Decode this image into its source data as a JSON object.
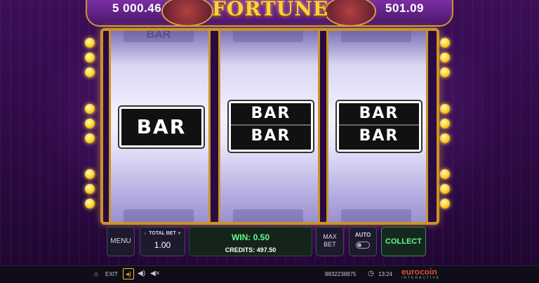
{
  "header": {
    "balance_left": "5 000.46",
    "balance_right": "501.09",
    "logo_text": "FORTUNE"
  },
  "reels": [
    {
      "symbol_lines": [
        "BAR"
      ],
      "ghost_top": "BAR"
    },
    {
      "symbol_lines": [
        "BAR",
        "BAR"
      ]
    },
    {
      "symbol_lines": [
        "BAR",
        "BAR"
      ]
    }
  ],
  "controls": {
    "menu_label": "MENU",
    "total_bet_label": "TOTAL BET",
    "total_bet_minus": "-",
    "total_bet_plus": "+",
    "total_bet_value": "1.00",
    "win_text": "WIN: 0.50",
    "credits_text": "CREDITS: 497.50",
    "max_bet_line1": "MAX",
    "max_bet_line2": "BET",
    "auto_label": "AUTO",
    "collect_label": "COLLECT"
  },
  "bottom_bar": {
    "exit_label": "EXIT",
    "session_id": "8832238875",
    "time": "13:24",
    "brand": "eurocoin",
    "brand_sub": "INTERACTIVE"
  },
  "icons": {
    "home": "home-icon",
    "speaker": "speaker-icon",
    "volume": "volume-icon",
    "mute": "mute-icon",
    "clock": "clock-icon"
  },
  "colors": {
    "win_green": "#5cff8a",
    "frame_gold": "#c9942a",
    "brand_red": "#e5502f"
  }
}
